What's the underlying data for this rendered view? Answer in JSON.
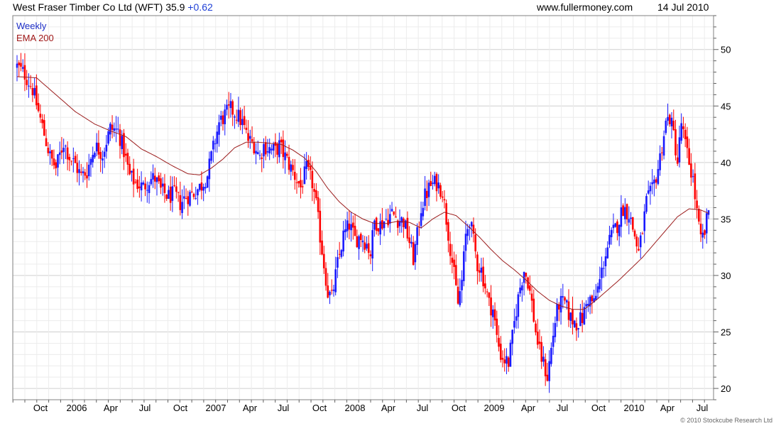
{
  "header": {
    "title": "West Fraser Timber Co Ltd (WFT)",
    "last_price": "35.9",
    "change": "+0.62",
    "site": "www.fullermoney.com",
    "date": "14 Jul 2010"
  },
  "footer": {
    "copyright": "© 2010 Stockcube Research Ltd"
  },
  "colors": {
    "up": "#1a1aff",
    "down": "#ff0000",
    "ema": "#9b1c1c",
    "grid": "#d6d6d6"
  },
  "chart_data": {
    "type": "candlestick",
    "interval_label": "Weekly",
    "legend": [
      "Weekly",
      "EMA 200"
    ],
    "ylim": [
      19,
      53
    ],
    "y_ticks": [
      20,
      25,
      30,
      35,
      40,
      45,
      50
    ],
    "x_ticks": [
      "Oct",
      "2006",
      "Apr",
      "Jul",
      "Oct",
      "2007",
      "Apr",
      "Jul",
      "Oct",
      "2008",
      "Apr",
      "Jul",
      "Oct",
      "2009",
      "Apr",
      "Jul",
      "Oct",
      "2010",
      "Apr",
      "Jul"
    ],
    "grid": true,
    "y_axis_side": "right",
    "price_path": [
      [
        0,
        48.5
      ],
      [
        4,
        47.8
      ],
      [
        8,
        46.5
      ],
      [
        11,
        44.5
      ],
      [
        14,
        42.5
      ],
      [
        17,
        40.5
      ],
      [
        20,
        39.5
      ],
      [
        24,
        41.8
      ],
      [
        27,
        40.5
      ],
      [
        30,
        39.8
      ],
      [
        33,
        38.8
      ],
      [
        36,
        39.2
      ],
      [
        40,
        41.5
      ],
      [
        44,
        40.8
      ],
      [
        48,
        43.0
      ],
      [
        52,
        42.8
      ],
      [
        55,
        41.0
      ],
      [
        58,
        38.8
      ],
      [
        61,
        38.2
      ],
      [
        65,
        37.8
      ],
      [
        68,
        38.5
      ],
      [
        71,
        38.6
      ],
      [
        74,
        37.5
      ],
      [
        78,
        37.0
      ],
      [
        81,
        37.2
      ],
      [
        84,
        36.4
      ],
      [
        87,
        37.0
      ],
      [
        91,
        37.3
      ],
      [
        95,
        38.0
      ],
      [
        98,
        38.9
      ],
      [
        100,
        40.5
      ],
      [
        102,
        42.0
      ],
      [
        104,
        43.5
      ],
      [
        107,
        44.2
      ],
      [
        110,
        44.7
      ],
      [
        113,
        44.3
      ],
      [
        116,
        43.5
      ],
      [
        119,
        42.0
      ],
      [
        122,
        41.6
      ],
      [
        125,
        40.5
      ],
      [
        127,
        41.5
      ],
      [
        130,
        41.2
      ],
      [
        133,
        41.0
      ],
      [
        135,
        41.5
      ],
      [
        138,
        40.5
      ],
      [
        141,
        39.5
      ],
      [
        144,
        38.5
      ],
      [
        146,
        37.8
      ],
      [
        149,
        39.4
      ],
      [
        152,
        38.2
      ],
      [
        154,
        36.2
      ],
      [
        156,
        33.5
      ],
      [
        158,
        31.0
      ],
      [
        160,
        28.5
      ],
      [
        162,
        28.0
      ],
      [
        165,
        31.0
      ],
      [
        168,
        33.5
      ],
      [
        171,
        34.5
      ],
      [
        174,
        33.2
      ],
      [
        177,
        33.5
      ],
      [
        180,
        32.8
      ],
      [
        182,
        32.0
      ],
      [
        184,
        34.8
      ],
      [
        187,
        34.5
      ],
      [
        190,
        35.0
      ],
      [
        193,
        35.5
      ],
      [
        196,
        35.0
      ],
      [
        199,
        34.8
      ],
      [
        202,
        33.0
      ],
      [
        204,
        31.5
      ],
      [
        206,
        33.5
      ],
      [
        208,
        36.0
      ],
      [
        210,
        37.0
      ],
      [
        213,
        38.0
      ],
      [
        216,
        38.2
      ],
      [
        219,
        37.5
      ],
      [
        221,
        35.0
      ],
      [
        223,
        32.5
      ],
      [
        225,
        30.0
      ],
      [
        227,
        27.5
      ],
      [
        229,
        29.5
      ],
      [
        231,
        33.5
      ],
      [
        233,
        35.0
      ],
      [
        235,
        33.0
      ],
      [
        237,
        31.0
      ],
      [
        239,
        30.5
      ],
      [
        241,
        29.0
      ],
      [
        243,
        27.5
      ],
      [
        245,
        27.0
      ],
      [
        247,
        24.5
      ],
      [
        249,
        23.0
      ],
      [
        251,
        22.5
      ],
      [
        253,
        22.3
      ],
      [
        255,
        24.5
      ],
      [
        257,
        27.0
      ],
      [
        259,
        29.0
      ],
      [
        261,
        30.5
      ],
      [
        263,
        29.5
      ],
      [
        265,
        27.5
      ],
      [
        267,
        25.0
      ],
      [
        269,
        23.2
      ],
      [
        271,
        22.2
      ],
      [
        273,
        21.0
      ],
      [
        275,
        23.5
      ],
      [
        277,
        26.0
      ],
      [
        279,
        27.5
      ],
      [
        282,
        27.5
      ],
      [
        285,
        26.2
      ],
      [
        288,
        25.8
      ],
      [
        291,
        26.2
      ],
      [
        294,
        28.0
      ],
      [
        297,
        27.5
      ],
      [
        300,
        29.5
      ],
      [
        303,
        32.0
      ],
      [
        306,
        33.5
      ],
      [
        309,
        34.5
      ],
      [
        312,
        36.0
      ],
      [
        315,
        35.5
      ],
      [
        318,
        33.5
      ],
      [
        320,
        32.0
      ],
      [
        322,
        34.0
      ],
      [
        324,
        36.5
      ],
      [
        327,
        37.5
      ],
      [
        330,
        39.5
      ],
      [
        332,
        41.5
      ],
      [
        334,
        43.5
      ],
      [
        336,
        44.0
      ],
      [
        338,
        42.5
      ],
      [
        340,
        40.0
      ],
      [
        342,
        43.5
      ],
      [
        344,
        41.5
      ],
      [
        346,
        40.0
      ],
      [
        348,
        38.5
      ],
      [
        350,
        35.5
      ],
      [
        352,
        33.0
      ],
      [
        354,
        33.8
      ],
      [
        356,
        35.8
      ]
    ],
    "ema_path": [
      [
        0,
        47.6
      ],
      [
        10,
        47.5
      ],
      [
        20,
        46.0
      ],
      [
        30,
        44.5
      ],
      [
        40,
        43.4
      ],
      [
        48,
        42.8
      ],
      [
        56,
        42.3
      ],
      [
        64,
        41.2
      ],
      [
        72,
        40.5
      ],
      [
        80,
        39.7
      ],
      [
        88,
        39.0
      ],
      [
        94,
        38.9
      ],
      [
        100,
        39.5
      ],
      [
        106,
        40.3
      ],
      [
        112,
        41.3
      ],
      [
        118,
        41.8
      ],
      [
        124,
        41.8
      ],
      [
        130,
        41.7
      ],
      [
        136,
        41.6
      ],
      [
        142,
        41.1
      ],
      [
        148,
        40.4
      ],
      [
        154,
        39.2
      ],
      [
        160,
        37.7
      ],
      [
        166,
        36.5
      ],
      [
        172,
        35.6
      ],
      [
        178,
        35.0
      ],
      [
        184,
        34.6
      ],
      [
        190,
        34.6
      ],
      [
        196,
        34.8
      ],
      [
        202,
        34.7
      ],
      [
        208,
        34.2
      ],
      [
        214,
        35.0
      ],
      [
        220,
        35.6
      ],
      [
        226,
        35.3
      ],
      [
        232,
        34.4
      ],
      [
        238,
        33.4
      ],
      [
        244,
        32.3
      ],
      [
        250,
        31.3
      ],
      [
        256,
        30.5
      ],
      [
        262,
        29.6
      ],
      [
        268,
        28.6
      ],
      [
        274,
        27.8
      ],
      [
        280,
        27.3
      ],
      [
        286,
        27.0
      ],
      [
        292,
        27.0
      ],
      [
        298,
        27.8
      ],
      [
        304,
        28.7
      ],
      [
        310,
        29.6
      ],
      [
        316,
        30.6
      ],
      [
        322,
        31.6
      ],
      [
        328,
        32.8
      ],
      [
        334,
        34.0
      ],
      [
        340,
        35.2
      ],
      [
        346,
        35.9
      ],
      [
        352,
        35.8
      ],
      [
        356,
        35.5
      ]
    ],
    "series": [
      {
        "name": "Weekly"
      },
      {
        "name": "EMA 200"
      }
    ]
  }
}
